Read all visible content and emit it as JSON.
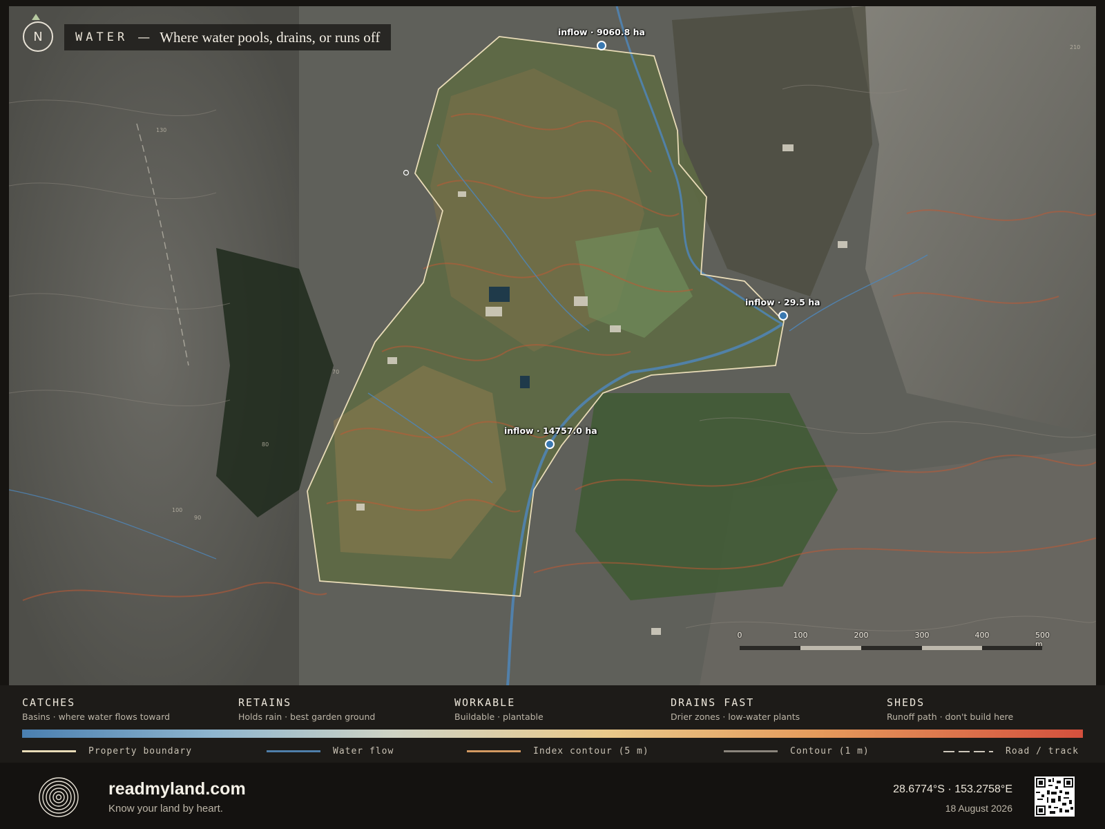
{
  "header": {
    "north_label": "N",
    "kicker": "WATER",
    "dash": "—",
    "subtitle": "Where water pools, drains, or runs off"
  },
  "map": {
    "inflows": [
      {
        "label": "inflow · 9060.8 ha"
      },
      {
        "label": "inflow · 29.5 ha"
      },
      {
        "label": "inflow · 14757.0 ha"
      }
    ],
    "contour_labels": [
      "130",
      "70",
      "80",
      "100",
      "90",
      "210"
    ],
    "scale_bar": {
      "ticks": [
        "0",
        "100",
        "200",
        "300",
        "400",
        "500 m"
      ]
    }
  },
  "legend": {
    "categories": [
      {
        "name": "CATCHES",
        "desc": "Basins · where water flows toward"
      },
      {
        "name": "RETAINS",
        "desc": "Holds rain · best garden ground"
      },
      {
        "name": "WORKABLE",
        "desc": "Buildable · plantable"
      },
      {
        "name": "DRAINS FAST",
        "desc": "Drier zones · low-water plants"
      },
      {
        "name": "SHEDS",
        "desc": "Runoff path · don't build here"
      }
    ],
    "keys": [
      {
        "label": "Property boundary",
        "color": "#e9dcb8"
      },
      {
        "label": "Water flow",
        "color": "#4f7faa"
      },
      {
        "label": "Index contour (5 m)",
        "color": "#d49a62"
      },
      {
        "label": "Contour (1 m)",
        "color": "#8a857c"
      },
      {
        "label": "Road / track",
        "color": "#cfc9bd"
      }
    ],
    "gradient_colors": [
      "#4a7fb0",
      "#8fb6cf",
      "#cfd3c4",
      "#e9c98a",
      "#e59b5c",
      "#d4503d"
    ]
  },
  "footer": {
    "brand": "readmyland.com",
    "tagline": "Know your land by heart.",
    "coords": "28.6774°S · 153.2758°E",
    "date": "18 August 2026"
  }
}
